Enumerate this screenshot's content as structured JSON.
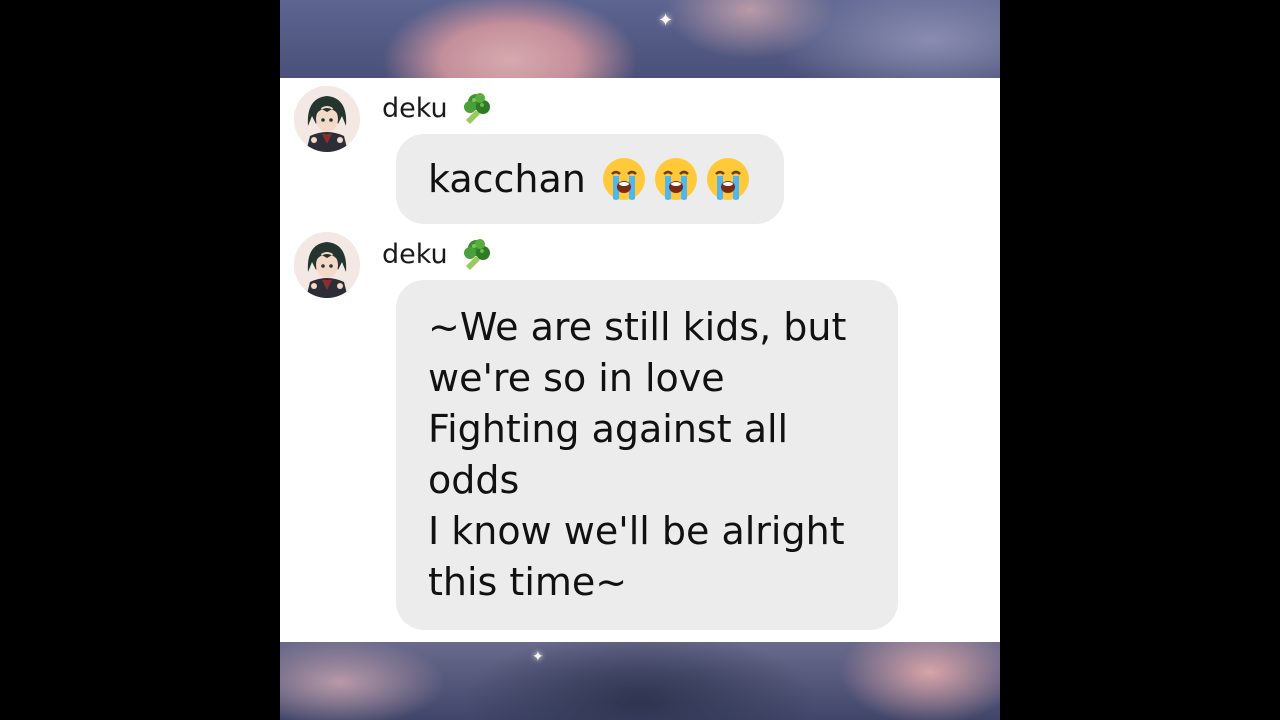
{
  "messages": [
    {
      "sender": "deku",
      "sender_icon": "broccoli-icon",
      "text": "kacchan",
      "emojis": [
        "loudly-crying-face-icon",
        "loudly-crying-face-icon",
        "loudly-crying-face-icon"
      ]
    },
    {
      "sender": "deku",
      "sender_icon": "broccoli-icon",
      "lines": [
        "~We are still kids, but",
        "we're so in love",
        "Fighting against all",
        "odds",
        "I know we'll be alright",
        "this time~"
      ]
    }
  ],
  "colors": {
    "chat_background": "#ffffff",
    "bubble": "#ececec",
    "text": "#111111",
    "side_bars": "#000000"
  }
}
